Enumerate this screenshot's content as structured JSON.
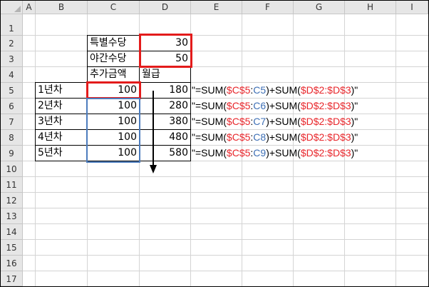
{
  "columns": [
    "A",
    "B",
    "C",
    "D",
    "E",
    "F",
    "G",
    "H",
    "I"
  ],
  "rows": [
    "1",
    "2",
    "3",
    "4",
    "5",
    "6",
    "7",
    "8",
    "9",
    "10",
    "11",
    "12",
    "13",
    "14",
    "15",
    "16",
    "17"
  ],
  "cells": {
    "c2": "특별수당",
    "d2": "30",
    "c3": "야간수당",
    "d3": "50",
    "c4": "추가금액",
    "d4": "월급"
  },
  "table_rows": [
    {
      "b": "1년차",
      "c": "100",
      "d": "180",
      "end_ref": "C5"
    },
    {
      "b": "2년차",
      "c": "100",
      "d": "280",
      "end_ref": "C6"
    },
    {
      "b": "3년차",
      "c": "100",
      "d": "380",
      "end_ref": "C7"
    },
    {
      "b": "4년차",
      "c": "100",
      "d": "480",
      "end_ref": "C8"
    },
    {
      "b": "5년차",
      "c": "100",
      "d": "580",
      "end_ref": "C9"
    }
  ],
  "formula_parts": {
    "open": "\"=SUM(",
    "range_start": "$C$5",
    "colon": ":",
    "mid": ")+SUM(",
    "d_range": "$D$2:$D$3",
    "close": ")\""
  },
  "colors": {
    "red_highlight": "#e31b1b",
    "blue_highlight": "#4c7cbd",
    "ref_red": "#e8262b",
    "ref_blue": "#3e6fb5"
  }
}
